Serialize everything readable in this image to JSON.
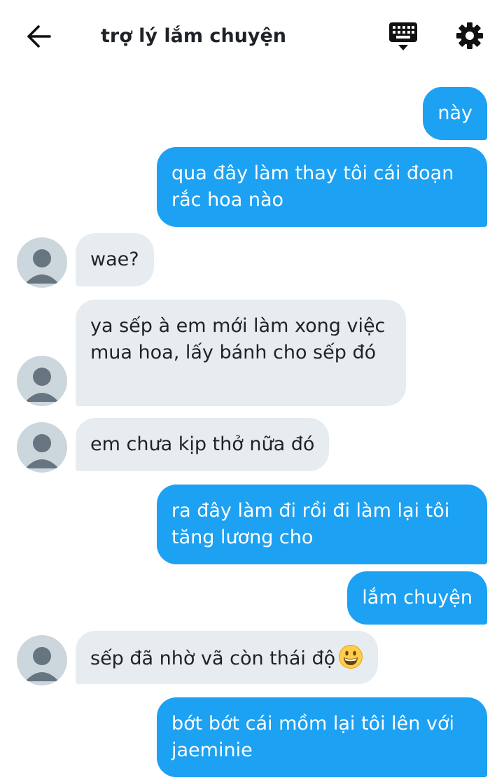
{
  "header": {
    "title": "trợ lý lắm chuyện",
    "back_icon": "arrow-left-icon",
    "keyboard_icon": "keyboard-icon",
    "settings_icon": "gear-icon"
  },
  "colors": {
    "outgoing_bubble": "#1da1f2",
    "incoming_bubble": "#e6ecf0",
    "avatar_placeholder": "#ccd6dd"
  },
  "messages": [
    {
      "direction": "out",
      "text": "này"
    },
    {
      "direction": "out",
      "text": "qua đây làm thay tôi cái đoạn rắc hoa nào"
    },
    {
      "direction": "in",
      "text": "wae?"
    },
    {
      "direction": "in",
      "text": "ya sếp à em mới làm xong việc mua hoa, lấy bánh cho sếp đó"
    },
    {
      "direction": "in",
      "text": "em chưa kịp thở nữa đó"
    },
    {
      "direction": "out",
      "text": "ra đây làm đi rồi đi làm lại tôi tăng lương cho"
    },
    {
      "direction": "out",
      "text": "lắm chuyện"
    },
    {
      "direction": "in",
      "text": "sếp đã nhờ vã còn thái độ",
      "emoji": "grinning-face-emoji"
    },
    {
      "direction": "out",
      "text": "bớt bớt cái mồm lại tôi lên với jaeminie"
    }
  ]
}
